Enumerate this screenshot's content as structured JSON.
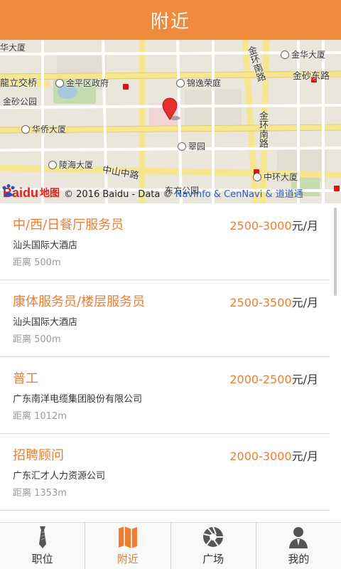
{
  "header": {
    "title": "附近"
  },
  "map": {
    "labels": {
      "jinhua_top_left": "华大厦",
      "lizhang_bridge": "龍立交桥",
      "jinping_gov": "金平区政府",
      "jinsha_park": "金砂公园",
      "huaqiao_tower": "华侨大厦",
      "lingdao_tower": "陵海大厦",
      "zhongshan_road": "中山中路",
      "jinyi_ting": "锦逸荣庭",
      "cuiyuan": "翠园",
      "jinhuan_south_1": "金环南路",
      "jinhuan_south_2": "金环南路",
      "jinhua_tower": "金华大厦",
      "jinsha_road": "金砂东路",
      "zhonghuan_tower": "中环大厦",
      "dongfang_park": "东方公园"
    },
    "copyright": {
      "logo_text": "Bai",
      "logo_text2": "du",
      "logo_map": "地图",
      "text": "© 2016 Baidu - Data ©",
      "navinfo": "NavInfo & CenNavi & 道道通"
    }
  },
  "jobs": [
    {
      "title": "中/西/日餐厅服务员",
      "salary_range": "2500-3000",
      "salary_unit": "元/月",
      "company": "汕头国际大酒店",
      "distance": "距离 500m"
    },
    {
      "title": "康体服务员/楼层服务员",
      "salary_range": "2500-3500",
      "salary_unit": "元/月",
      "company": "汕头国际大酒店",
      "distance": "距离 500m"
    },
    {
      "title": "普工",
      "salary_range": "2000-2500",
      "salary_unit": "元/月",
      "company": "广东南洋电缆集团股份有限公司",
      "distance": "距离 1012m"
    },
    {
      "title": "招聘顾问",
      "salary_range": "2000-3000",
      "salary_unit": "元/月",
      "company": "广东汇才人力资源公司",
      "distance": "距离 1353m"
    }
  ],
  "tabs": [
    {
      "label": "职位",
      "icon": "tie-icon",
      "active": false
    },
    {
      "label": "附近",
      "icon": "map-icon",
      "active": true
    },
    {
      "label": "广场",
      "icon": "aperture-icon",
      "active": false
    },
    {
      "label": "我的",
      "icon": "person-icon",
      "active": false
    }
  ],
  "colors": {
    "accent": "#ee7d34",
    "header": "#f08a3c"
  }
}
